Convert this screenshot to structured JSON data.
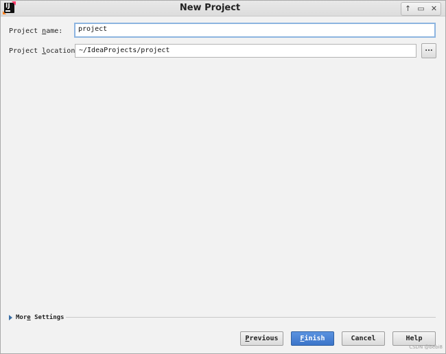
{
  "window": {
    "title": "New Project",
    "controls": [
      "↑",
      "▭",
      "✕"
    ]
  },
  "form": {
    "name": {
      "label_pre": "Project ",
      "label_mnemonic": "n",
      "label_post": "ame:",
      "value": "project"
    },
    "location": {
      "label_pre": "Project ",
      "label_mnemonic": "l",
      "label_post": "ocation:",
      "value": "~/IdeaProjects/project",
      "browse_label": "..."
    }
  },
  "more_settings": {
    "label_pre": "Mor",
    "label_mnemonic": "e",
    "label_post": " Settings"
  },
  "buttons": {
    "previous": {
      "mnemonic": "P",
      "rest": "revious"
    },
    "finish": {
      "mnemonic": "F",
      "rest": "inish"
    },
    "cancel": {
      "label": "Cancel"
    },
    "help": {
      "label": "Help"
    }
  },
  "watermark": "CSDN @bebi8"
}
